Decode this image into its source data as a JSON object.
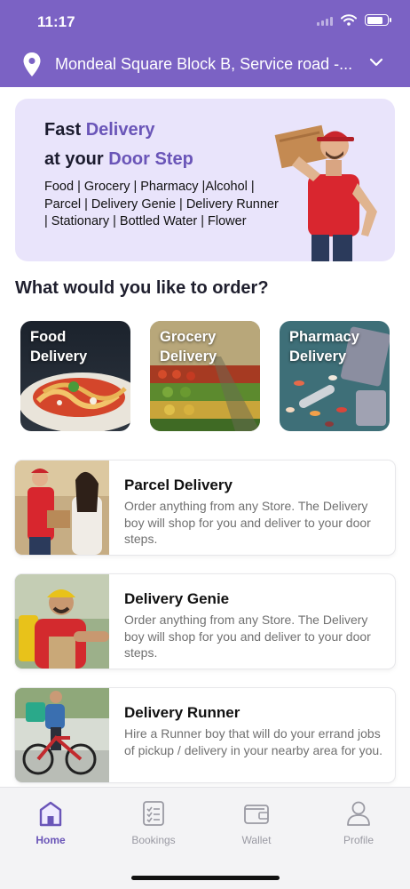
{
  "status_bar": {
    "time": "11:17"
  },
  "location": {
    "address": "Mondeal Square Block B, Service road -..."
  },
  "banner": {
    "line1_plain": "Fast ",
    "line1_highlight": "Delivery",
    "line2_plain": "at your ",
    "line2_highlight": "Door Step",
    "services_list": "Food | Grocery | Pharmacy |Alcohol | Parcel | Delivery Genie | Delivery Runner | Stationary | Bottled Water | Flower"
  },
  "order_section": {
    "title": "What would you like to order?",
    "categories": [
      {
        "line1": "Food",
        "line2": "Delivery"
      },
      {
        "line1": "Grocery",
        "line2": "Delivery"
      },
      {
        "line1": "Pharmacy",
        "line2": "Delivery"
      }
    ]
  },
  "services": [
    {
      "title": "Parcel Delivery",
      "description": "Order anything from any Store. The Delivery boy will shop for you and deliver to your door steps."
    },
    {
      "title": "Delivery Genie",
      "description": "Order anything from any Store. The Delivery boy will shop for you and deliver to your door steps."
    },
    {
      "title": "Delivery Runner",
      "description": "Hire a Runner boy that will do your errand jobs of pickup / delivery in your nearby area for you."
    }
  ],
  "bottom_nav": [
    {
      "label": "Home",
      "icon": "home-icon",
      "active": true
    },
    {
      "label": "Bookings",
      "icon": "checklist-icon",
      "active": false
    },
    {
      "label": "Wallet",
      "icon": "wallet-icon",
      "active": false
    },
    {
      "label": "Profile",
      "icon": "user-icon",
      "active": false
    }
  ],
  "colors": {
    "brand_purple": "#7b62c4",
    "highlight_purple": "#6a55b8",
    "banner_bg": "#e9e4fb"
  }
}
